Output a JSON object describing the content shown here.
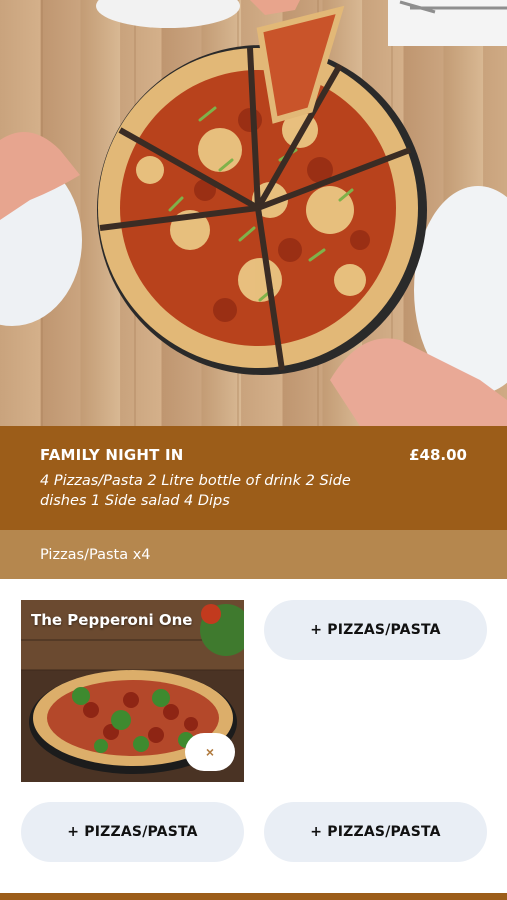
{
  "deal": {
    "title": "FAMILY NIGHT IN",
    "price": "£48.00",
    "description": "4 Pizzas/Pasta 2 Litre bottle of drink 2 Side dishes 1 Side salad 4 Dips"
  },
  "section": {
    "label": "Pizzas/Pasta x4"
  },
  "slots": {
    "selected": {
      "name": "The Pepperoni One",
      "remove_label": "×"
    },
    "add_label": "+ PIZZAS/PASTA"
  },
  "colors": {
    "deal_header": "#9c5d19",
    "section_bar": "#b5874e",
    "add_button": "#e9eef5"
  }
}
